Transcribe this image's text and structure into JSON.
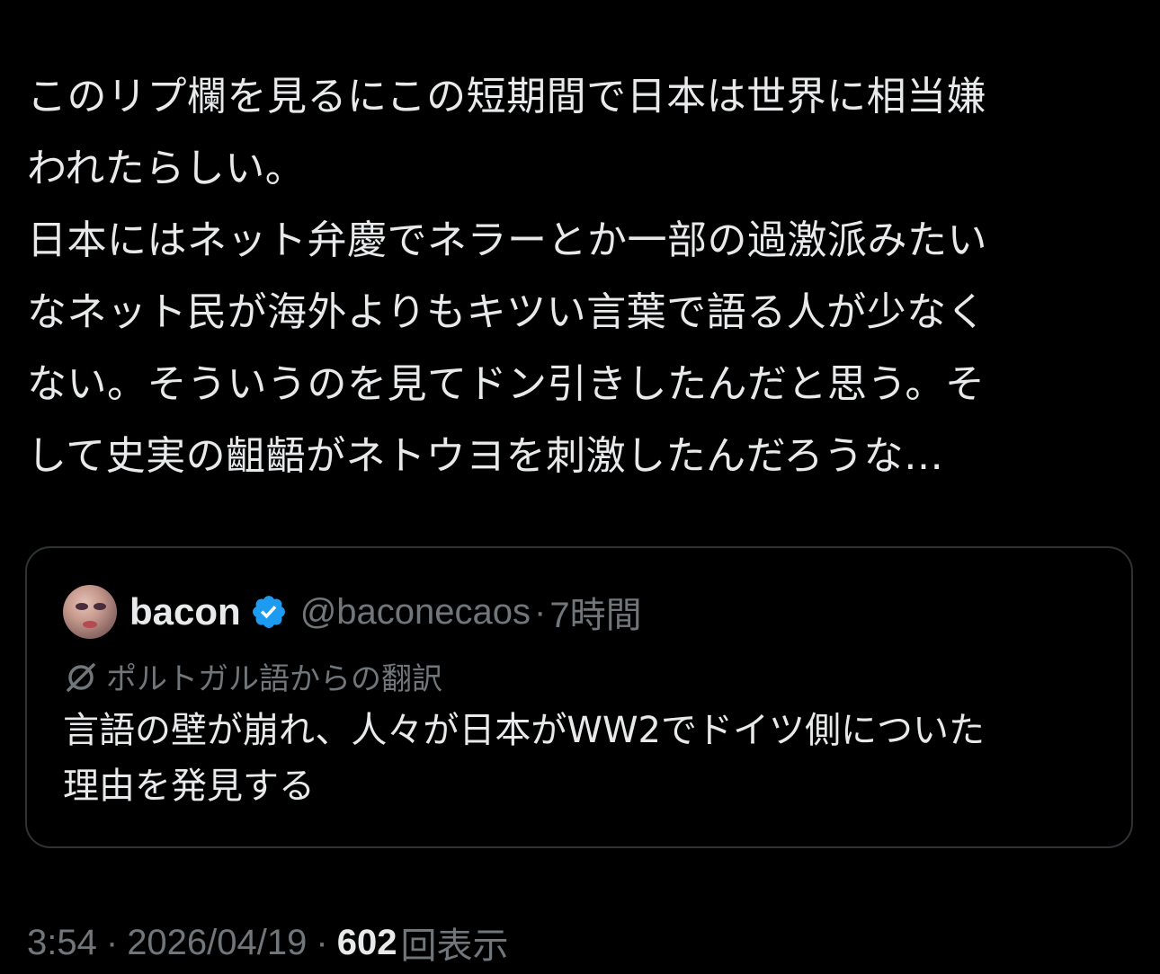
{
  "tweet": {
    "lines": [
      "このリプ欄を見るにこの短期間で日本は世界に相当嫌",
      "われたらしい。",
      "日本にはネット弁慶でネラーとか一部の過激派みたい",
      "なネット民が海外よりもキツい言葉で語る人が少なく",
      "ない。そういうのを見てドン引きしたんだと思う。そ",
      "して史実の齟齬がネトウヨを刺激したんだろうな…"
    ]
  },
  "quote": {
    "avatar_icon": "user-avatar",
    "display_name": "bacon",
    "verified_icon": "verified-badge-icon",
    "verified_color": "#1d9bf0",
    "handle": "@baconecaos",
    "separator": "·",
    "time": "7時間",
    "translation_icon": "translate-icon",
    "translation_label": "ポルトガル語からの翻訳",
    "lines": [
      "言語の壁が崩れ、人々が日本がWW2でドイツ側についた",
      "理由を発見する"
    ]
  },
  "meta": {
    "time": "3:54",
    "separator": "·",
    "date": "2026/04/19",
    "view_count": "602",
    "views_label": "回表示"
  },
  "colors": {
    "background": "#000000",
    "text_primary": "#e7e9ea",
    "text_secondary": "#71767b",
    "border": "#2f3336"
  }
}
